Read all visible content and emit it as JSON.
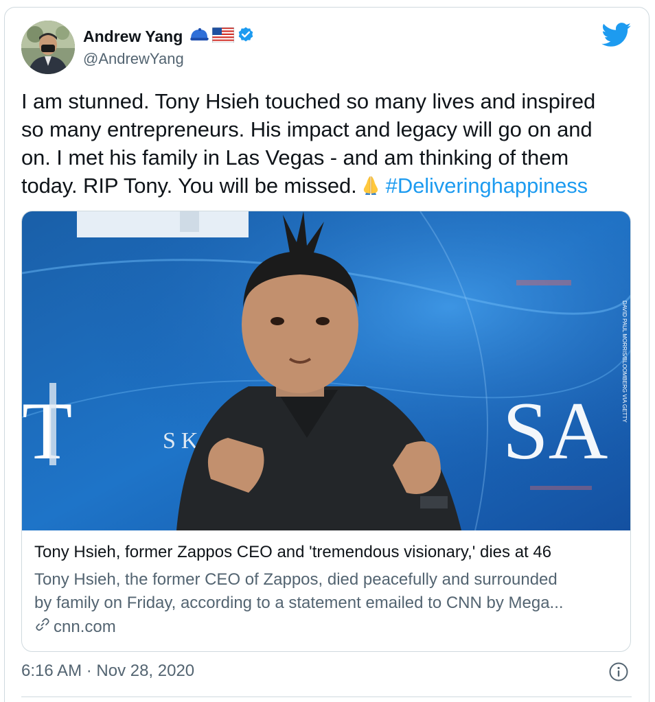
{
  "author": {
    "name": "Andrew Yang",
    "handle": "@AndrewYang",
    "badges": [
      "blue-cap-emoji",
      "us-flag-emoji",
      "verified-badge-icon"
    ]
  },
  "tweet": {
    "lines": [
      "I am stunned. Tony Hsieh touched so many lives and inspired",
      "so many entrepreneurs. His impact and legacy will go on and",
      "on. I met his family in Las Vegas - and am thinking of them",
      "today. RIP Tony. You will be missed."
    ],
    "emoji": "folded-hands-emoji",
    "hashtag": "#Deliveringhappiness"
  },
  "link_card": {
    "image_description_icon": "photo-of-speaker",
    "title": "Tony Hsieh, former Zappos CEO and 'tremendous visionary,' dies at 46",
    "description_line1": "Tony Hsieh, the former CEO of Zappos, died peacefully and surrounded",
    "description_line2": "by family on Friday, according to a statement emailed to CNN by Mega...",
    "domain": "cnn.com"
  },
  "footer": {
    "timestamp": "6:16 AM · Nov 28, 2020"
  },
  "colors": {
    "accent": "#1d9bf0",
    "text_primary": "#0f1419",
    "text_secondary": "#536471",
    "border": "#cfd9de"
  }
}
